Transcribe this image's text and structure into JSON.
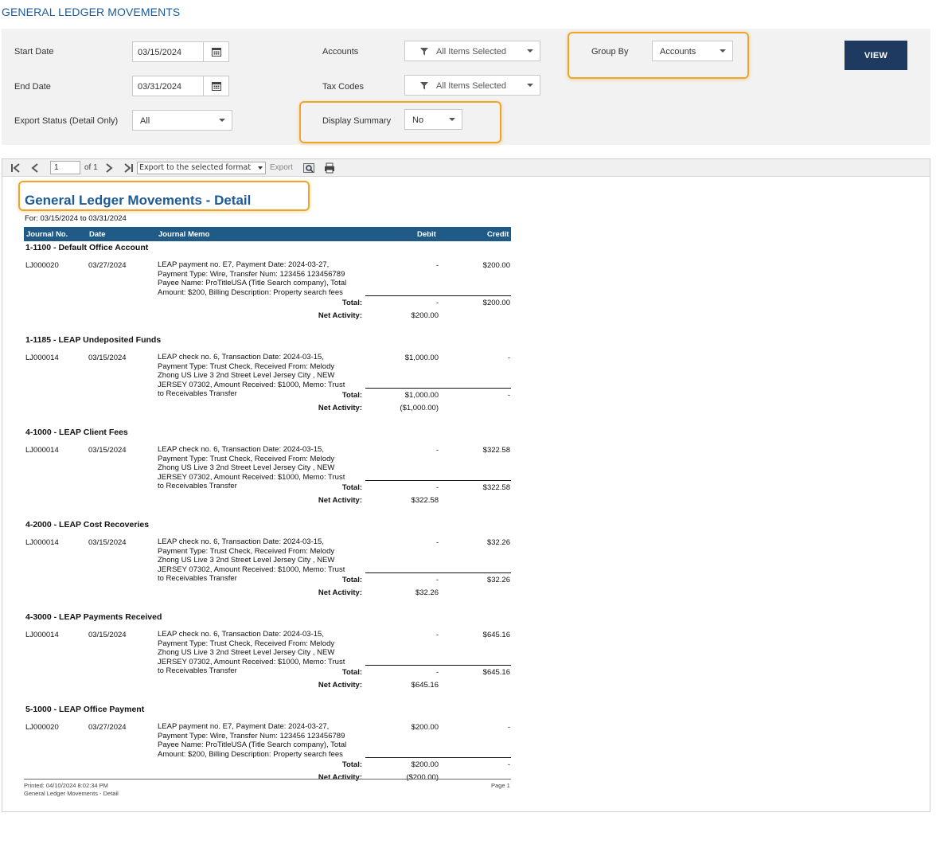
{
  "page": {
    "title": "GENERAL LEDGER MOVEMENTS"
  },
  "filters": {
    "start_date_label": "Start Date",
    "start_date_value": "03/15/2024",
    "end_date_label": "End Date",
    "end_date_value": "03/31/2024",
    "export_status_label": "Export Status (Detail Only)",
    "export_status_value": "All",
    "accounts_label": "Accounts",
    "accounts_value": "All Items Selected",
    "tax_codes_label": "Tax Codes",
    "tax_codes_value": "All Items Selected",
    "display_summary_label": "Display Summary",
    "display_summary_value": "No",
    "group_by_label": "Group By",
    "group_by_value": "Accounts",
    "view_label": "VIEW"
  },
  "toolbar": {
    "page_value": "1",
    "page_of": "of 1",
    "export_format": "Export to the selected format",
    "export_label": "Export"
  },
  "report": {
    "title": "General Ledger Movements - Detail",
    "for": "For: 03/15/2024 to 03/31/2024",
    "columns": {
      "journal": "Journal No.",
      "date": "Date",
      "memo": "Journal Memo",
      "debit": "Debit",
      "credit": "Credit"
    },
    "total_label": "Total:",
    "net_label": "Net Activity:",
    "sections": [
      {
        "heading": "1-1100 - Default Office Account",
        "journal": "LJ000020",
        "date": "03/27/2024",
        "memo": [
          "LEAP payment no. E7, Payment Date: 2024-03-27,",
          "Payment Type: Wire, Transfer Num: 123456 123456789",
          "Payee Name: ProTitleUSA (Title Search company), Total",
          "Amount: $200, Billing Description: Property search fees"
        ],
        "debit": "-",
        "credit": "$200.00",
        "total_debit": "-",
        "total_credit": "$200.00",
        "net": "$200.00"
      },
      {
        "heading": "1-1185 - LEAP Undeposited Funds",
        "journal": "LJ000014",
        "date": "03/15/2024",
        "memo": [
          "LEAP check no. 6, Transaction Date: 2024-03-15,",
          "Payment Type: Trust Check, Received From: Melody",
          "Zhong US Live 3 2nd Street Level Jersey City , NEW",
          "JERSEY 07302, Amount Received: $1000, Memo: Trust",
          "to Receivables Transfer"
        ],
        "debit": "$1,000.00",
        "credit": "-",
        "total_debit": "$1,000.00",
        "total_credit": "-",
        "net": "($1,000.00)"
      },
      {
        "heading": "4-1000 - LEAP Client Fees",
        "journal": "LJ000014",
        "date": "03/15/2024",
        "memo": [
          "LEAP check no. 6, Transaction Date: 2024-03-15,",
          "Payment Type: Trust Check, Received From: Melody",
          "Zhong US Live 3 2nd Street Level Jersey City , NEW",
          "JERSEY 07302, Amount Received: $1000, Memo: Trust",
          "to Receivables Transfer"
        ],
        "debit": "-",
        "credit": "$322.58",
        "total_debit": "-",
        "total_credit": "$322.58",
        "net": "$322.58"
      },
      {
        "heading": "4-2000 - LEAP Cost Recoveries",
        "journal": "LJ000014",
        "date": "03/15/2024",
        "memo": [
          "LEAP check no. 6, Transaction Date: 2024-03-15,",
          "Payment Type: Trust Check, Received From: Melody",
          "Zhong US Live 3 2nd Street Level Jersey City , NEW",
          "JERSEY 07302, Amount Received: $1000, Memo: Trust",
          "to Receivables Transfer"
        ],
        "debit": "-",
        "credit": "$32.26",
        "total_debit": "-",
        "total_credit": "$32.26",
        "net": "$32.26"
      },
      {
        "heading": "4-3000 - LEAP Payments Received",
        "journal": "LJ000014",
        "date": "03/15/2024",
        "memo": [
          "LEAP check no. 6, Transaction Date: 2024-03-15,",
          "Payment Type: Trust Check, Received From: Melody",
          "Zhong US Live 3 2nd Street Level Jersey City , NEW",
          "JERSEY 07302, Amount Received: $1000, Memo: Trust",
          "to Receivables Transfer"
        ],
        "debit": "-",
        "credit": "$645.16",
        "total_debit": "-",
        "total_credit": "$645.16",
        "net": "$645.16"
      },
      {
        "heading": "5-1000 - LEAP Office Payment",
        "journal": "LJ000020",
        "date": "03/27/2024",
        "memo": [
          "LEAP payment no. E7, Payment Date: 2024-03-27,",
          "Payment Type: Wire, Transfer Num: 123456 123456789",
          "Payee Name: ProTitleUSA (Title Search company), Total",
          "Amount: $200, Billing Description: Property search fees"
        ],
        "debit": "$200.00",
        "credit": "-",
        "total_debit": "$200.00",
        "total_credit": "-",
        "net": "($200.00)"
      }
    ],
    "footer_printed": "Printed: 04/10/2024 8:02:34 PM",
    "footer_name": "General Ledger Movements - Detail",
    "footer_page": "Page 1"
  },
  "colors": {
    "brand_blue": "#1d5a96",
    "header_blue": "#1f5b86",
    "view_button": "#1f3a60",
    "highlight": "#f0a52a",
    "panel": "#f2f2f2"
  }
}
